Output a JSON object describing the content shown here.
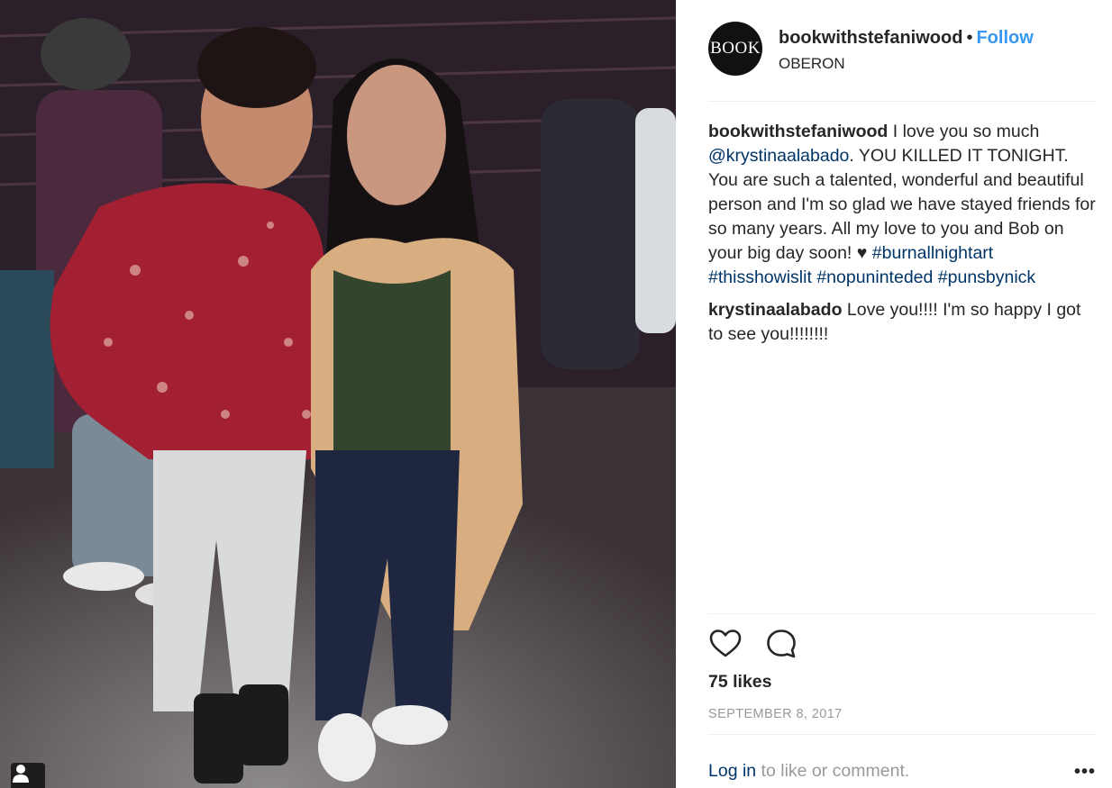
{
  "photo": {
    "alt_subject": "photo",
    "tag_icon": "user-tag-icon"
  },
  "post": {
    "username": "bookwithstefaniwood",
    "separator": "•",
    "follow_label": "Follow",
    "location": "OBERON",
    "avatar_text": "BOOK"
  },
  "caption": {
    "username": "bookwithstefaniwood",
    "text_1": " I love you so much ",
    "mention": "@krystinaalabado",
    "text_2": ". YOU KILLED IT TONIGHT. You are such a talented, wonderful and beautiful person and I'm so glad we have stayed friends for so many years. All my love to you and Bob on your big day soon! ♥",
    "hashtags": [
      "#burnallnightart",
      "#thisshowislit",
      "#nopuninteded",
      "#punsbynick"
    ]
  },
  "reply": {
    "username": "krystinaalabado",
    "text": " Love you!!!! I'm so happy I got to see you!!!!!!!!"
  },
  "actions": {
    "like_icon": "heart-icon",
    "comment_icon": "comment-bubble-icon"
  },
  "likes": "75 likes",
  "date": "SEPTEMBER 8, 2017",
  "footer": {
    "login_link": "Log in",
    "login_text": " to like or comment.",
    "more_label": "•••"
  },
  "colors": {
    "follow": "#3897f0",
    "link": "#003569",
    "muted": "#999999",
    "text": "#262626"
  }
}
